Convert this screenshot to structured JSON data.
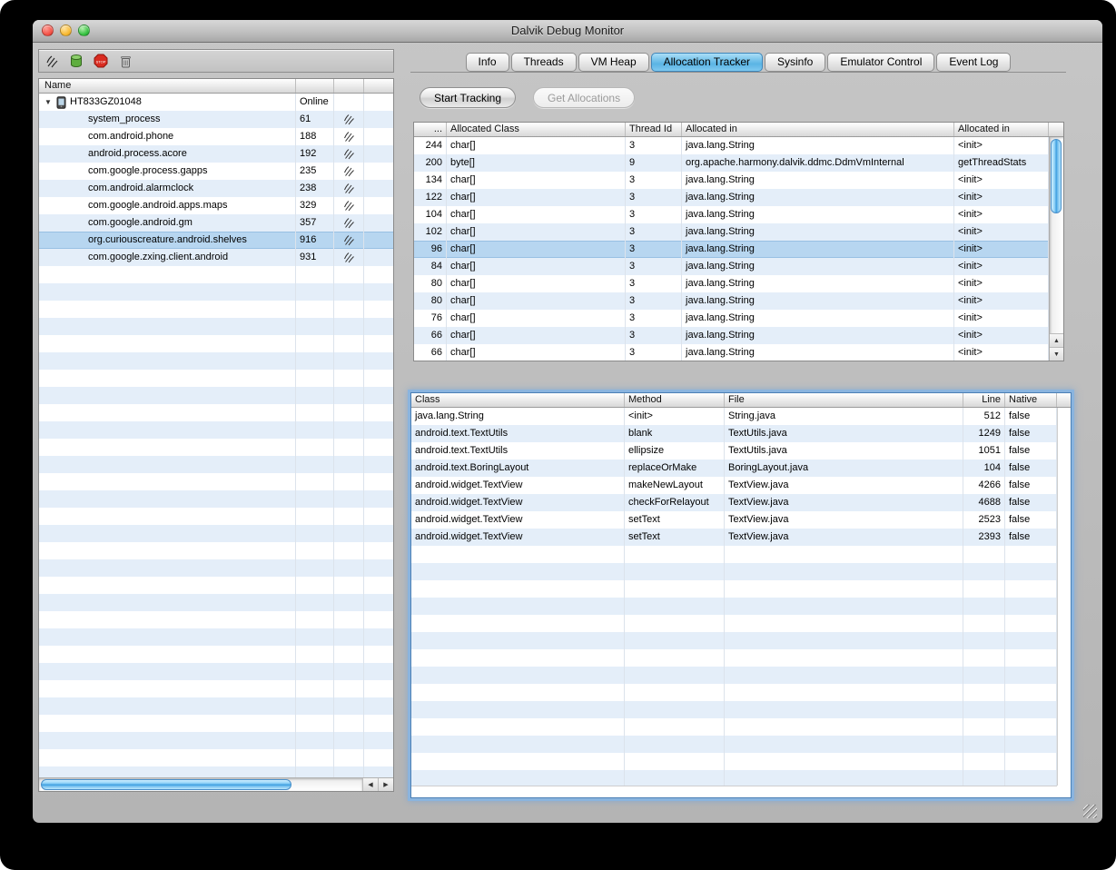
{
  "window": {
    "title": "Dalvik Debug Monitor"
  },
  "colors": {
    "selection": "#b7d6f0",
    "row_stripe": "#e4eef9",
    "tab_selected": "#5ab4e4",
    "focus_ring": "#8ab4de",
    "scrollbar_aqua": "#3f9fe0"
  },
  "left_panel": {
    "toolbar": {
      "icons": [
        "update-threads-icon",
        "update-heap-icon",
        "stop-process-icon",
        "gc-icon"
      ]
    },
    "columns": [
      "Name",
      "",
      "",
      ""
    ],
    "device": {
      "name": "HT833GZ01048",
      "status": "Online"
    },
    "processes": [
      {
        "name": "system_process",
        "pid": "61"
      },
      {
        "name": "com.android.phone",
        "pid": "188"
      },
      {
        "name": "android.process.acore",
        "pid": "192"
      },
      {
        "name": "com.google.process.gapps",
        "pid": "235"
      },
      {
        "name": "com.android.alarmclock",
        "pid": "238"
      },
      {
        "name": "com.google.android.apps.maps",
        "pid": "329"
      },
      {
        "name": "com.google.android.gm",
        "pid": "357"
      },
      {
        "name": "org.curiouscreature.android.shelves",
        "pid": "916",
        "selected": true
      },
      {
        "name": "com.google.zxing.client.android",
        "pid": "931"
      }
    ]
  },
  "right_panel": {
    "tabs": [
      {
        "label": "Info"
      },
      {
        "label": "Threads"
      },
      {
        "label": "VM Heap"
      },
      {
        "label": "Allocation Tracker",
        "selected": true
      },
      {
        "label": "Sysinfo"
      },
      {
        "label": "Emulator Control"
      },
      {
        "label": "Event Log"
      }
    ],
    "buttons": {
      "start_tracking": "Start Tracking",
      "get_allocations": "Get Allocations"
    },
    "allocations_table": {
      "columns": [
        "...",
        "Allocated Class",
        "Thread Id",
        "Allocated in",
        "Allocated in"
      ],
      "selected_index": 6,
      "rows": [
        [
          "244",
          "char[]",
          "3",
          "java.lang.String",
          "<init>"
        ],
        [
          "200",
          "byte[]",
          "9",
          "org.apache.harmony.dalvik.ddmc.DdmVmInternal",
          "getThreadStats"
        ],
        [
          "134",
          "char[]",
          "3",
          "java.lang.String",
          "<init>"
        ],
        [
          "122",
          "char[]",
          "3",
          "java.lang.String",
          "<init>"
        ],
        [
          "104",
          "char[]",
          "3",
          "java.lang.String",
          "<init>"
        ],
        [
          "102",
          "char[]",
          "3",
          "java.lang.String",
          "<init>"
        ],
        [
          "96",
          "char[]",
          "3",
          "java.lang.String",
          "<init>"
        ],
        [
          "84",
          "char[]",
          "3",
          "java.lang.String",
          "<init>"
        ],
        [
          "80",
          "char[]",
          "3",
          "java.lang.String",
          "<init>"
        ],
        [
          "80",
          "char[]",
          "3",
          "java.lang.String",
          "<init>"
        ],
        [
          "76",
          "char[]",
          "3",
          "java.lang.String",
          "<init>"
        ],
        [
          "66",
          "char[]",
          "3",
          "java.lang.String",
          "<init>"
        ],
        [
          "66",
          "char[]",
          "3",
          "java.lang.String",
          "<init>"
        ]
      ]
    },
    "stack_table": {
      "columns": [
        "Class",
        "Method",
        "File",
        "Line",
        "Native"
      ],
      "rows": [
        [
          "java.lang.String",
          "<init>",
          "String.java",
          "512",
          "false"
        ],
        [
          "android.text.TextUtils",
          "blank",
          "TextUtils.java",
          "1249",
          "false"
        ],
        [
          "android.text.TextUtils",
          "ellipsize",
          "TextUtils.java",
          "1051",
          "false"
        ],
        [
          "android.text.BoringLayout",
          "replaceOrMake",
          "BoringLayout.java",
          "104",
          "false"
        ],
        [
          "android.widget.TextView",
          "makeNewLayout",
          "TextView.java",
          "4266",
          "false"
        ],
        [
          "android.widget.TextView",
          "checkForRelayout",
          "TextView.java",
          "4688",
          "false"
        ],
        [
          "android.widget.TextView",
          "setText",
          "TextView.java",
          "2523",
          "false"
        ],
        [
          "android.widget.TextView",
          "setText",
          "TextView.java",
          "2393",
          "false"
        ]
      ]
    }
  }
}
